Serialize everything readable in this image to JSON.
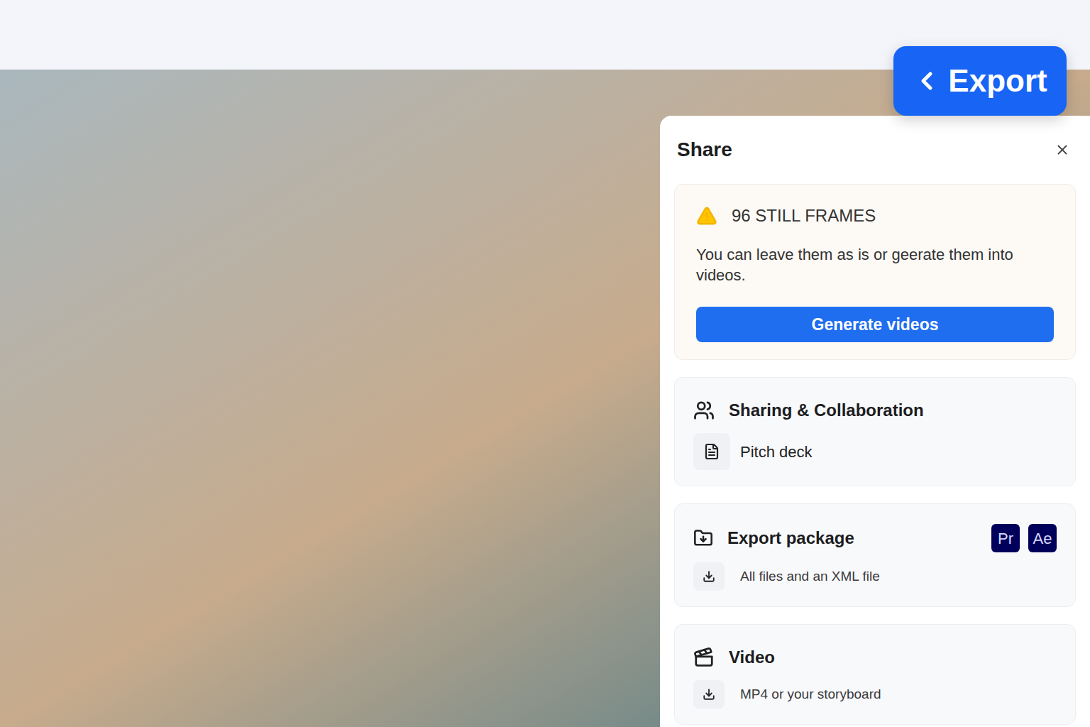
{
  "header": {
    "export_button": "Export"
  },
  "share_panel": {
    "title": "Share",
    "notice": {
      "title": "96 STILL FRAMES",
      "message": "You can leave them as is or geerate them into videos.",
      "button": "Generate videos"
    },
    "sections": [
      {
        "kind": "sharing",
        "title": "Sharing & Collaboration",
        "items": [
          {
            "label": "Pitch deck"
          }
        ],
        "badges": [],
        "subtitle": ""
      },
      {
        "kind": "export",
        "title": "Export package",
        "items": [],
        "badges": [
          "Pr",
          "Ae"
        ],
        "subtitle": "All files and an XML file"
      },
      {
        "kind": "video",
        "title": "Video",
        "items": [],
        "badges": [],
        "subtitle": "MP4 or your storyboard"
      }
    ]
  }
}
